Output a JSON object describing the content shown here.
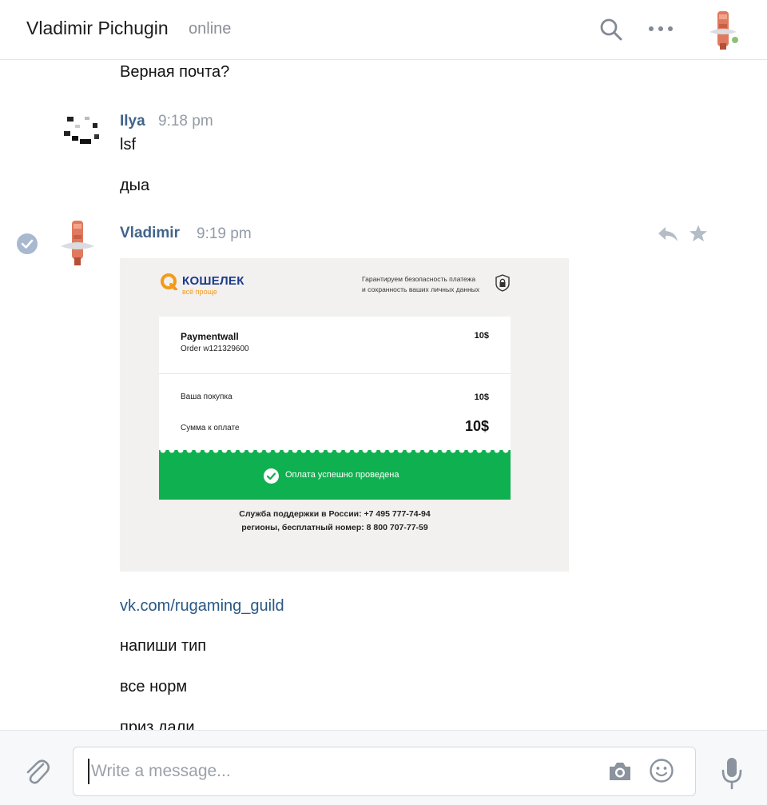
{
  "header": {
    "contact_name": "Vladimir Pichugin",
    "status": "online"
  },
  "messages": {
    "prev_text": "Верная почта?",
    "ilya": {
      "author": "Ilya",
      "time": "9:18 pm",
      "lines": [
        "lsf",
        "дыа"
      ]
    },
    "vladimir": {
      "author": "Vladimir",
      "time": "9:19 pm",
      "receipt": {
        "brand": "КОШЕЛЕК",
        "slogan": "всё проще",
        "guarantee_line1": "Гарантируем безопасность платежа",
        "guarantee_line2": "и сохранность ваших личных данных",
        "merchant": "Paymentwall",
        "order": "Order w121329600",
        "amount": "10$",
        "purchase_label": "Ваша покупка",
        "purchase_amount": "10$",
        "total_label": "Сумма к оплате",
        "total_amount": "10$",
        "success_text": "Оплата успешно проведена",
        "support_line1": "Служба поддержки в России: +7 495 777-74-94",
        "support_line2": "регионы, бесплатный номер: 8 800 707-77-59"
      },
      "link": "vk.com/rugaming_guild",
      "lines": [
        "напиши тип",
        "все норм",
        "приз дали"
      ]
    }
  },
  "composer": {
    "placeholder": "Write a message..."
  },
  "colors": {
    "author": "#42648b",
    "link": "#2a5885",
    "success_green": "#0fb04f",
    "online_dot": "#8ac176"
  },
  "icons": [
    "search-icon",
    "more-icon",
    "check-icon",
    "reply-icon",
    "star-icon",
    "attach-icon",
    "camera-icon",
    "emoji-icon",
    "mic-icon",
    "lock-icon"
  ]
}
